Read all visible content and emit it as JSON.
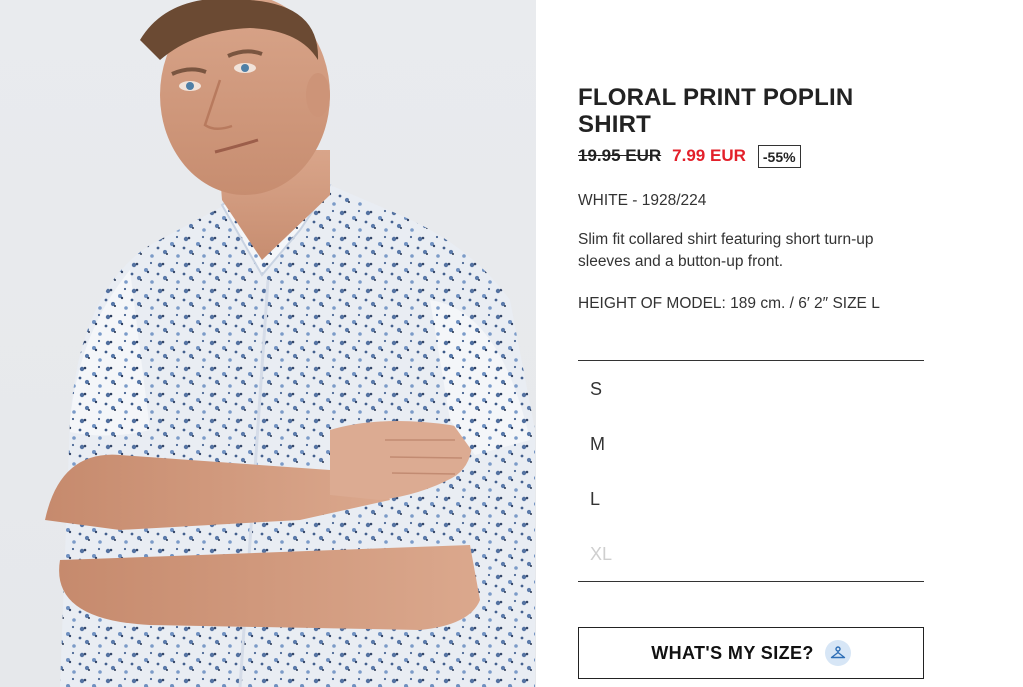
{
  "product": {
    "title": "FLORAL PRINT POPLIN SHIRT",
    "old_price": "19.95 EUR",
    "new_price": "7.99 EUR",
    "discount": "-55%",
    "color_ref": "WHITE - 1928/224",
    "description": "Slim fit collared shirt featuring short turn-up sleeves and a button-up front.",
    "model_info": "HEIGHT OF MODEL: 189 cm. / 6′ 2″ SIZE L"
  },
  "sizes": [
    {
      "label": "S",
      "available": true
    },
    {
      "label": "M",
      "available": true
    },
    {
      "label": "L",
      "available": true
    },
    {
      "label": "XL",
      "available": false
    }
  ],
  "size_help": {
    "label": "WHAT'S MY SIZE?",
    "icon": "hanger-icon"
  },
  "colors": {
    "sale_red": "#e3202a",
    "text": "#333333",
    "unavailable": "#cfcfcf",
    "icon_bg": "#d7e6f6"
  }
}
